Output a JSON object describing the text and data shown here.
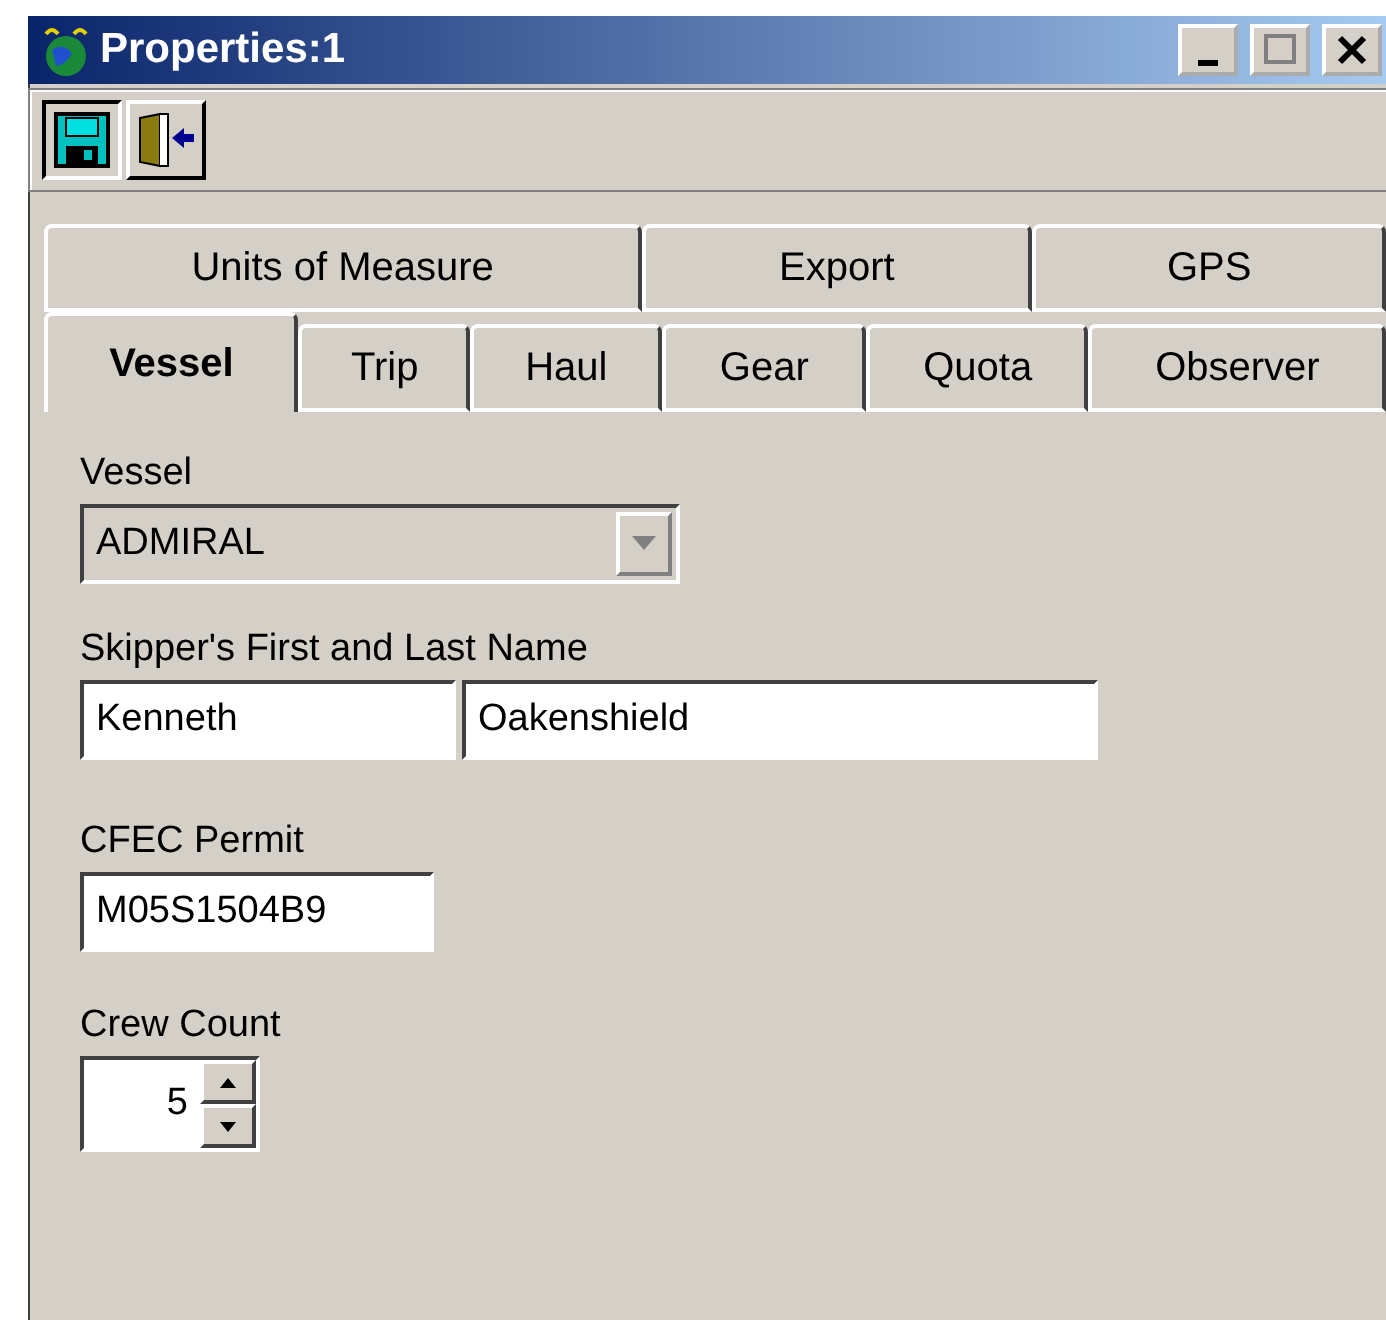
{
  "window": {
    "title": "Properties:1"
  },
  "toolbar": [
    {
      "kind": "save",
      "pressed": true
    },
    {
      "kind": "exit",
      "pressed": false
    }
  ],
  "tab_rows": [
    [
      {
        "label": "Units of Measure",
        "selected": false
      },
      {
        "label": "Export",
        "selected": false
      },
      {
        "label": "GPS",
        "selected": false
      }
    ],
    [
      {
        "label": "Vessel",
        "selected": true
      },
      {
        "label": "Trip",
        "selected": false
      },
      {
        "label": "Haul",
        "selected": false
      },
      {
        "label": "Gear",
        "selected": false
      },
      {
        "label": "Quota",
        "selected": false
      },
      {
        "label": "Observer",
        "selected": false
      }
    ]
  ],
  "vessel": {
    "label": "Vessel",
    "value": "ADMIRAL",
    "disabled": true
  },
  "skipper": {
    "label": "Skipper's First and Last Name",
    "first": "Kenneth",
    "last": "Oakenshield"
  },
  "permit": {
    "label": "CFEC Permit",
    "value": "M05S1504B9"
  },
  "crew": {
    "label": "Crew Count",
    "value": "5"
  }
}
